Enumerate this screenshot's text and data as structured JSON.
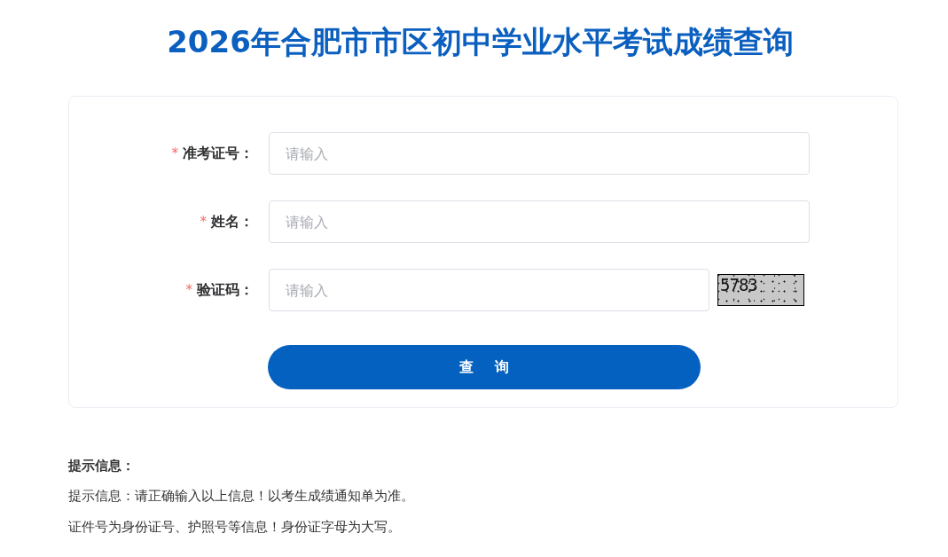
{
  "title": "2026年合肥市市区初中学业水平考试成绩查询",
  "form": {
    "fields": [
      {
        "kind": "text",
        "required_mark": "*",
        "label": "准考证号：",
        "placeholder": "请输入"
      },
      {
        "kind": "text",
        "required_mark": "*",
        "label": "姓名：",
        "placeholder": "请输入"
      },
      {
        "kind": "captcha",
        "required_mark": "*",
        "label": "验证码：",
        "placeholder": "请输入",
        "captcha": "5783"
      }
    ],
    "submit": "查 询"
  },
  "notes": {
    "heading": "提示信息：",
    "lines": [
      "提示信息：请正确输入以上信息！以考生成绩通知单为准。",
      "证件号为身份证号、护照号等信息！身份证字母为大写。"
    ]
  }
}
